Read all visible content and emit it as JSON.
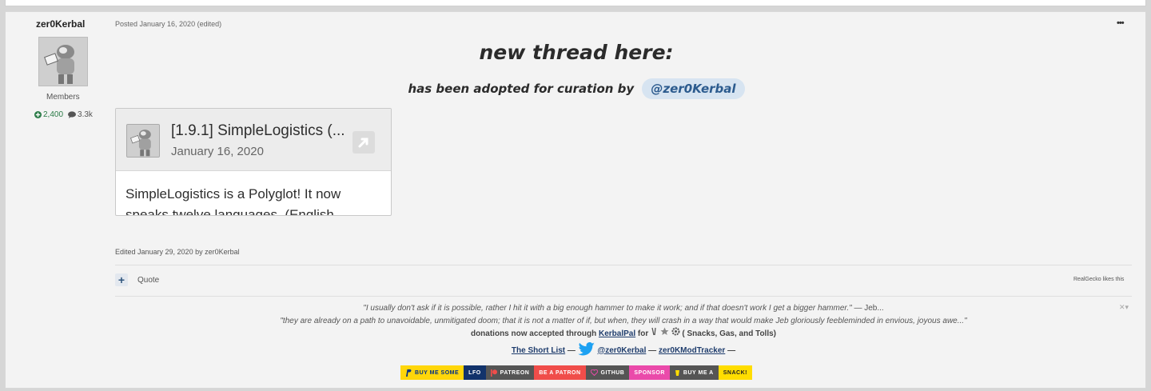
{
  "author": {
    "name": "zer0Kerbal",
    "group": "Members",
    "reputation": "2,400",
    "posts": "3.3k"
  },
  "post": {
    "meta_posted": "Posted January 16, 2020",
    "meta_edited": "(edited)",
    "more_label": "•••",
    "headline": "new thread here:",
    "subline": "has been adopted for curation by",
    "mention": "@zer0Kerbal",
    "embed": {
      "title": "[1.9.1] SimpleLogistics (...",
      "date": "January 16, 2020",
      "body": "SimpleLogistics is a Polyglot! It now speaks twelve languages. (English..."
    },
    "edited_line": "Edited January 29, 2020 by zer0Kerbal"
  },
  "controls": {
    "add_label": "+",
    "quote_label": "Quote",
    "likes": "RealGecko likes this"
  },
  "signature": {
    "quote1": "\"I usually don't ask if it is possible, rather I hit it with a big enough hammer to make it work; and if that doesn't work I get a bigger hammer.\"",
    "quote1_attr": "— Jeb...",
    "quote2": "\"they are already on a path to unavoidable, unmitigated doom; that it is not a matter of if, but when, they will crash in a way that would make Jeb gloriously feebleminded in envious, joyous awe...\"",
    "donations_pre": "donations now accepted through",
    "donations_link": "KerbalPal",
    "donations_for": "for",
    "donations_post": "( Snacks, Gas, and Tolls)",
    "shortlist": "The Short List",
    "twitter_handle": "@zer0Kerbal",
    "modtracker": "zer0KModTracker",
    "dash": "—",
    "close": "✕▾"
  },
  "badges": [
    {
      "left": "BUY ME SOME",
      "right": "LFO",
      "left_bg": "#ffd60a",
      "left_fg": "#003087",
      "right_bg": "#12336b",
      "right_fg": "#ffffff",
      "icon": "paypal-icon"
    },
    {
      "left": "PATREON",
      "right": "BE A PATRON",
      "left_bg": "#555555",
      "left_fg": "#ffffff",
      "right_bg": "#f04d4a",
      "right_fg": "#ffffff",
      "icon": "patreon-icon"
    },
    {
      "left": "GITHUB",
      "right": "SPONSOR",
      "left_bg": "#555555",
      "left_fg": "#ffffff",
      "right_bg": "#ea4aaa",
      "right_fg": "#ffffff",
      "icon": "heart-icon"
    },
    {
      "left": "BUY ME A",
      "right": "SNACK!",
      "left_bg": "#555555",
      "left_fg": "#ffffff",
      "right_bg": "#ffdd00",
      "right_fg": "#222222",
      "icon": "cup-icon"
    }
  ]
}
